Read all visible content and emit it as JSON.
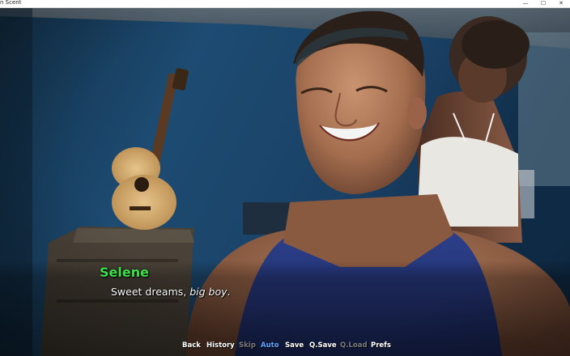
{
  "window": {
    "title": "n Scent",
    "controls": {
      "minimize": "—",
      "maximize": "☐",
      "close": "✕"
    }
  },
  "dialogue": {
    "speaker": "Selene",
    "speaker_color": "#3ee04a",
    "text_before": "Sweet dreams, ",
    "text_italic": "big boy",
    "text_after": "."
  },
  "quick_menu": {
    "back": "Back",
    "history": "History",
    "skip": "Skip",
    "auto": "Auto",
    "save": "Save",
    "qsave": "Q.Save",
    "qload": "Q.Load",
    "prefs": "Prefs",
    "active_color": "#57a6ff"
  }
}
